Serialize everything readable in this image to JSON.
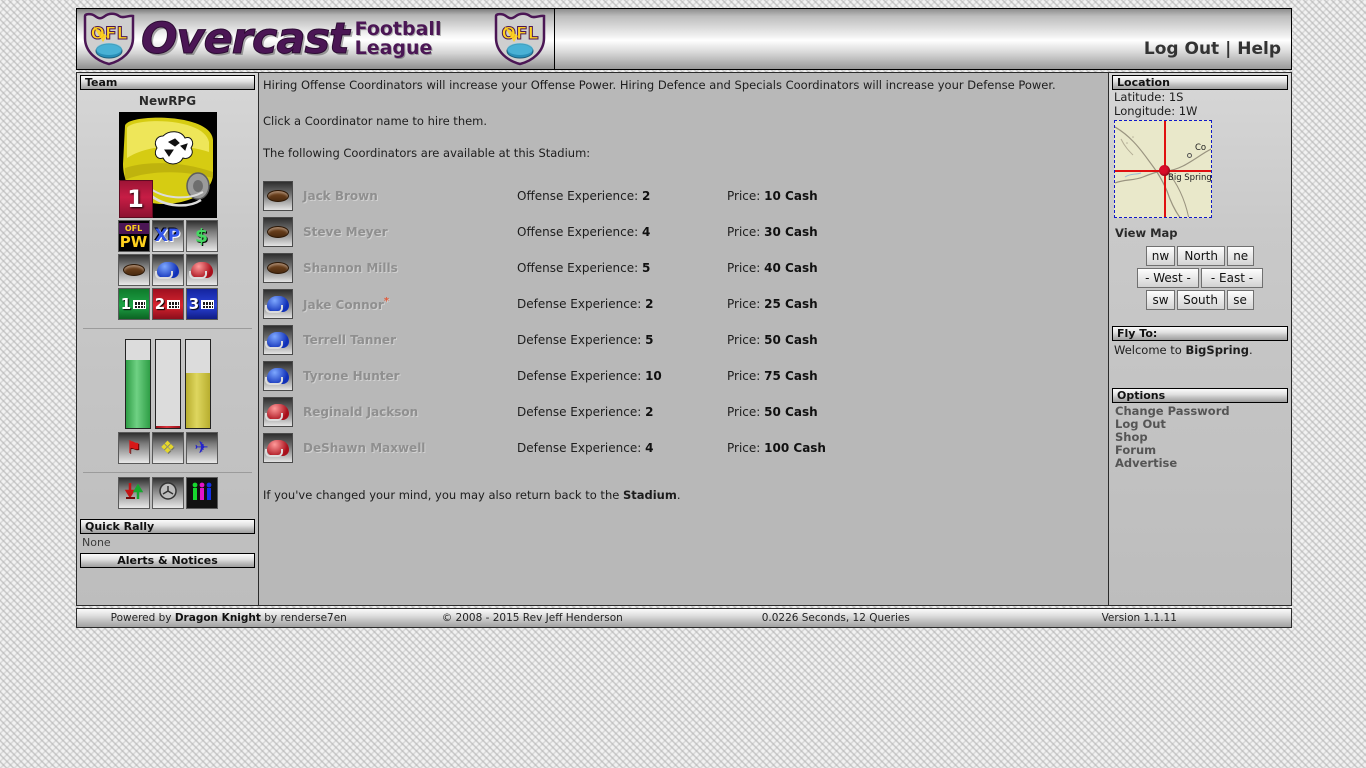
{
  "header": {
    "brand_main": "Overcast",
    "brand_line1": "Football",
    "brand_line2": "League",
    "shield_text": "OFL",
    "logout_label": "Log Out",
    "separator": "|",
    "help_label": "Help"
  },
  "sidebar_left": {
    "section_title": "Team",
    "team_name": "NewRPG",
    "rank": "1",
    "tiles_row1": [
      {
        "name": "power-tile",
        "line1": "OFL",
        "line2": "PW"
      },
      {
        "name": "xp-tile",
        "label": "XP"
      },
      {
        "name": "cash-tile",
        "label": "$"
      }
    ],
    "tiles_row2": [
      {
        "name": "football-tile"
      },
      {
        "name": "blue-helmet-tile"
      },
      {
        "name": "red-helmet-tile"
      }
    ],
    "tiles_row3": [
      {
        "name": "squad-1-tile",
        "label": "1"
      },
      {
        "name": "squad-2-tile",
        "label": "2"
      },
      {
        "name": "squad-3-tile",
        "label": "3"
      }
    ],
    "bars": [
      {
        "name": "health-bar",
        "fill_percent": 77,
        "color": "#3aa64f"
      },
      {
        "name": "energy-bar",
        "fill_percent": 2,
        "color": "#9b1018"
      },
      {
        "name": "stamina-bar",
        "fill_percent": 63,
        "color": "#cdc34d"
      }
    ],
    "action_icons": [
      {
        "name": "flag-icon",
        "glyph": "⚑"
      },
      {
        "name": "whistle-icon",
        "glyph": "♪"
      },
      {
        "name": "plane-icon",
        "glyph": "✈"
      }
    ],
    "util_icons": [
      {
        "name": "transfer-icon",
        "glyph": "⇅"
      },
      {
        "name": "clock-icon",
        "glyph": "⌚"
      },
      {
        "name": "people-icon",
        "glyph": "\u0000"
      }
    ],
    "quick_rally_title": "Quick Rally",
    "quick_rally_value": "None",
    "alerts_title": "Alerts & Notices"
  },
  "main": {
    "intro_1": "Hiring Offense Coordinators will increase your Offense Power. Hiring Defence and Specials Coordinators will increase your Defense Power.",
    "intro_2": "Click a Coordinator name to hire them.",
    "intro_3": "The following Coordinators are available at this Stadium:",
    "coordinators": [
      {
        "name": "Jack Brown",
        "starred": false,
        "type": "offense",
        "exp_label": "Offense Experience:",
        "exp": "2",
        "price_label": "Price:",
        "price": "10 Cash"
      },
      {
        "name": "Steve Meyer",
        "starred": false,
        "type": "offense",
        "exp_label": "Offense Experience:",
        "exp": "4",
        "price_label": "Price:",
        "price": "30 Cash"
      },
      {
        "name": "Shannon Mills",
        "starred": false,
        "type": "offense",
        "exp_label": "Offense Experience:",
        "exp": "5",
        "price_label": "Price:",
        "price": "40 Cash"
      },
      {
        "name": "Jake Connor",
        "starred": true,
        "type": "defense-blue",
        "exp_label": "Defense Experience:",
        "exp": "2",
        "price_label": "Price:",
        "price": "25 Cash"
      },
      {
        "name": "Terrell Tanner",
        "starred": false,
        "type": "defense-blue",
        "exp_label": "Defense Experience:",
        "exp": "5",
        "price_label": "Price:",
        "price": "50 Cash"
      },
      {
        "name": "Tyrone Hunter",
        "starred": false,
        "type": "defense-blue",
        "exp_label": "Defense Experience:",
        "exp": "10",
        "price_label": "Price:",
        "price": "75 Cash"
      },
      {
        "name": "Reginald Jackson",
        "starred": false,
        "type": "defense-red",
        "exp_label": "Defense Experience:",
        "exp": "2",
        "price_label": "Price:",
        "price": "50 Cash"
      },
      {
        "name": "DeShawn Maxwell",
        "starred": false,
        "type": "defense-red",
        "exp_label": "Defense Experience:",
        "exp": "4",
        "price_label": "Price:",
        "price": "100 Cash"
      }
    ],
    "return_prefix": "If you've changed your mind, you may also return back to the ",
    "return_link": "Stadium",
    "return_suffix": "."
  },
  "sidebar_right": {
    "location_title": "Location",
    "latitude": "Latitude: 1S",
    "longitude": "Longitude: 1W",
    "map_marker_label": "Big Spring",
    "map_node_label": "Co",
    "view_map_label": "View Map",
    "nav_buttons": {
      "nw": "nw",
      "north": "North",
      "ne": "ne",
      "west": "- West -",
      "east": "- East -",
      "sw": "sw",
      "south": "South",
      "se": "se"
    },
    "flyto_title": "Fly To:",
    "welcome_prefix": "Welcome to ",
    "welcome_place": "BigSpring",
    "welcome_suffix": ".",
    "options_title": "Options",
    "options": [
      "Change Password",
      "Log Out",
      "Shop",
      "Forum",
      "Advertise"
    ]
  },
  "footer": {
    "powered_prefix": "Powered by ",
    "powered_engine": "Dragon Knight",
    "powered_suffix": " by renderse7en",
    "copyright": "© 2008 - 2015 Rev Jeff Henderson",
    "perf": "0.0226 Seconds, 12 Queries",
    "version": "Version 1.1.11"
  }
}
